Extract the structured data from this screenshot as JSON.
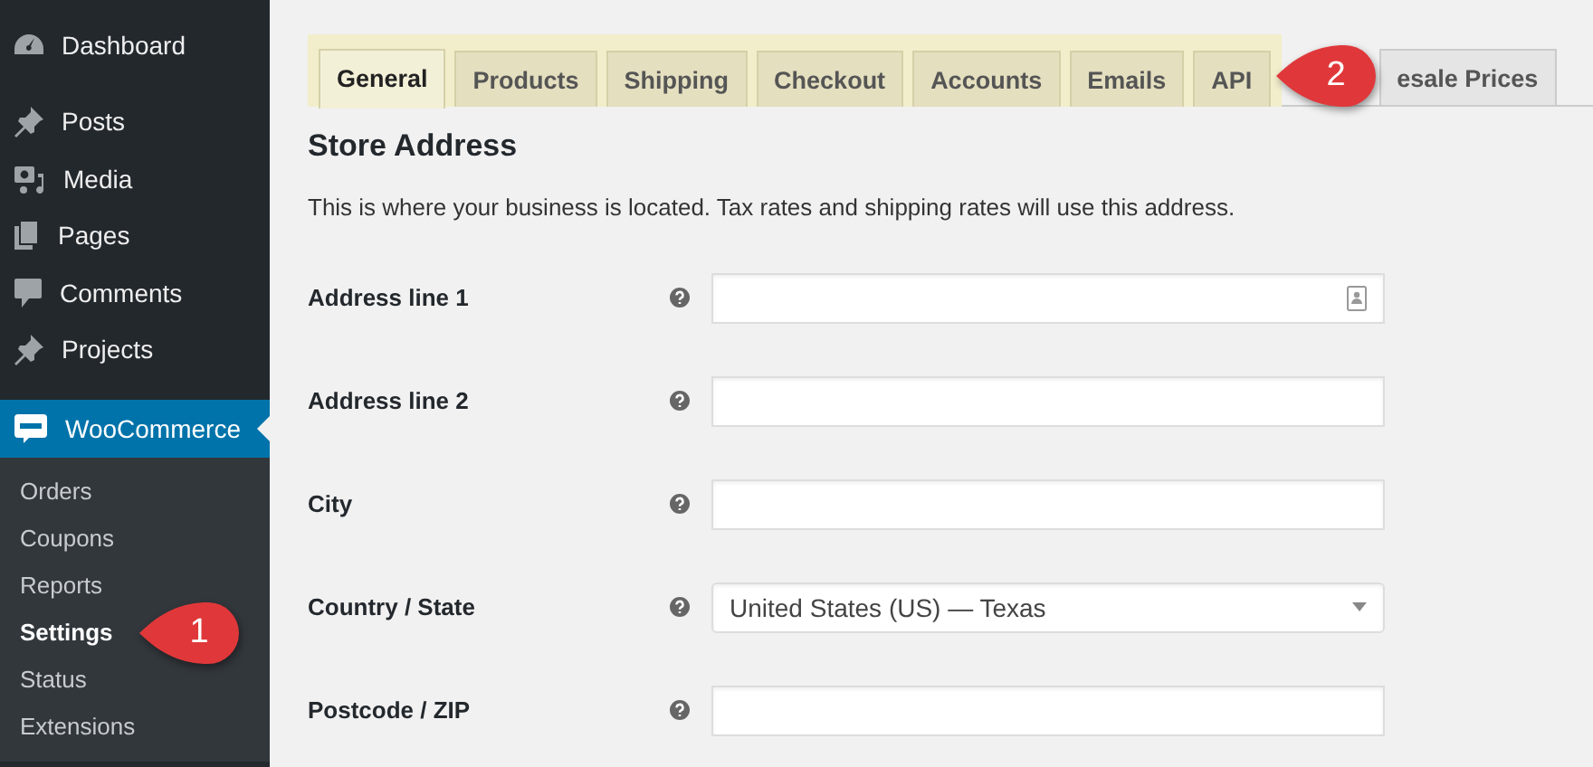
{
  "sidebar": {
    "menu": [
      {
        "label": "Dashboard",
        "selected": false
      },
      {
        "label": "Posts",
        "selected": false
      },
      {
        "label": "Media",
        "selected": false
      },
      {
        "label": "Pages",
        "selected": false
      },
      {
        "label": "Comments",
        "selected": false
      },
      {
        "label": "Projects",
        "selected": false
      },
      {
        "label": "WooCommerce",
        "selected": true
      }
    ],
    "submenu": [
      {
        "label": "Orders",
        "selected": false
      },
      {
        "label": "Coupons",
        "selected": false
      },
      {
        "label": "Reports",
        "selected": false
      },
      {
        "label": "Settings",
        "selected": true
      },
      {
        "label": "Status",
        "selected": false
      },
      {
        "label": "Extensions",
        "selected": false
      }
    ]
  },
  "tabs": [
    {
      "label": "General",
      "selected": true,
      "highlighted": true
    },
    {
      "label": "Products",
      "selected": false,
      "highlighted": true
    },
    {
      "label": "Shipping",
      "selected": false,
      "highlighted": true
    },
    {
      "label": "Checkout",
      "selected": false,
      "highlighted": true
    },
    {
      "label": "Accounts",
      "selected": false,
      "highlighted": true
    },
    {
      "label": "Emails",
      "selected": false,
      "highlighted": true
    },
    {
      "label": "API",
      "selected": false,
      "highlighted": true
    },
    {
      "label": "esale Prices",
      "selected": false,
      "highlighted": false
    }
  ],
  "section": {
    "title": "Store Address",
    "description": "This is where your business is located. Tax rates and shipping rates will use this address."
  },
  "fields": [
    {
      "label": "Address line 1",
      "kind": "text",
      "autofill": true
    },
    {
      "label": "Address line 2",
      "kind": "text",
      "autofill": false
    },
    {
      "label": "City",
      "kind": "text",
      "autofill": false
    },
    {
      "label": "Country / State",
      "kind": "select",
      "value": "United States (US) — Texas"
    },
    {
      "label": "Postcode / ZIP",
      "kind": "text",
      "autofill": false
    }
  ],
  "callouts": [
    {
      "number": "1"
    },
    {
      "number": "2"
    }
  ]
}
